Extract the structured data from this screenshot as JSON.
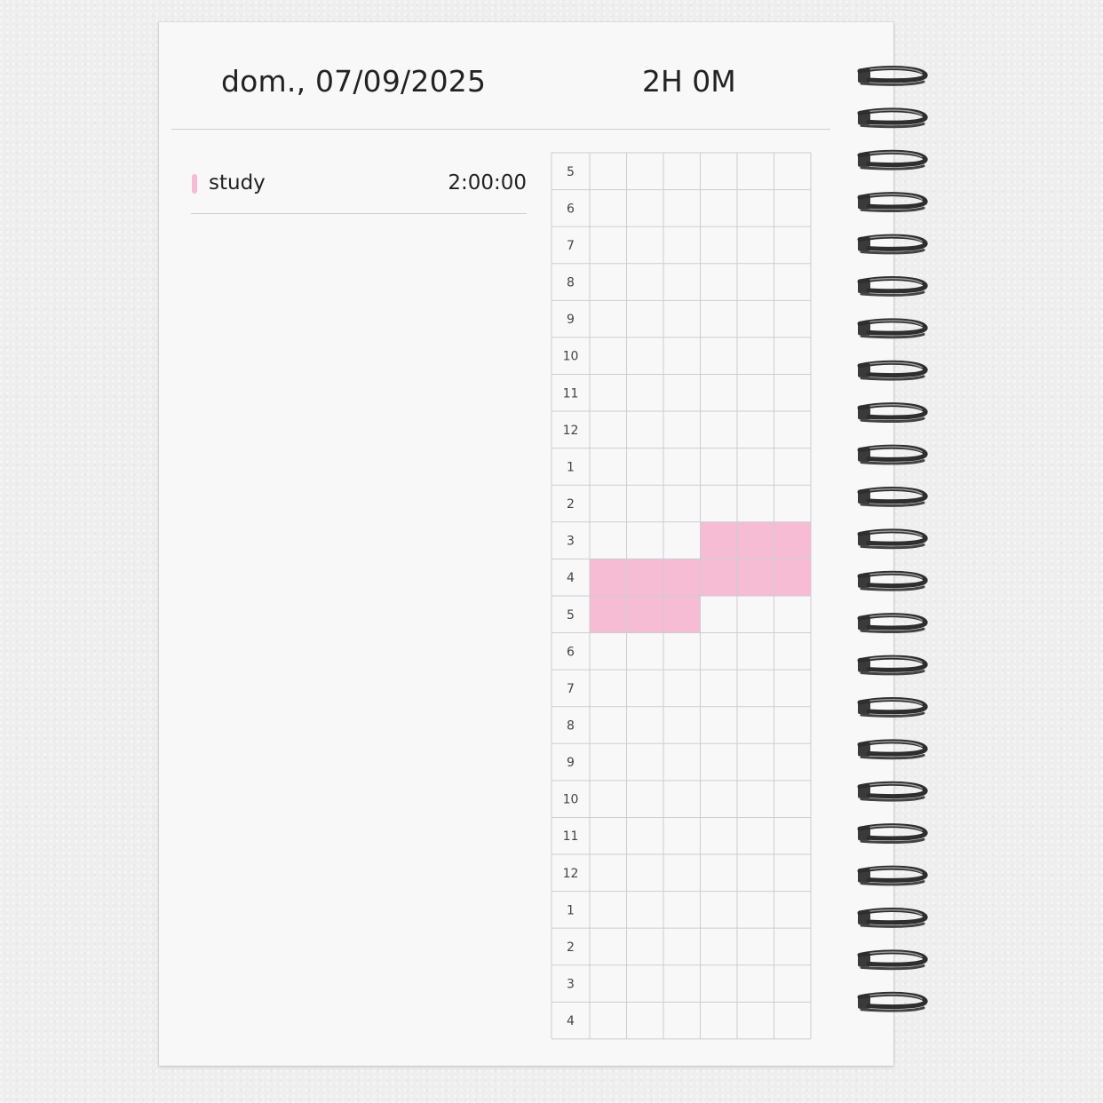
{
  "header": {
    "date": "dom., 07/09/2025",
    "total": "2H 0M"
  },
  "activities": [
    {
      "name": "study",
      "duration": "2:00:00",
      "color": "#f5bcd4"
    }
  ],
  "timeline": {
    "hour_labels": [
      "5",
      "6",
      "7",
      "8",
      "9",
      "10",
      "11",
      "12",
      "1",
      "2",
      "3",
      "4",
      "5",
      "6",
      "7",
      "8",
      "9",
      "10",
      "11",
      "12",
      "1",
      "2",
      "3",
      "4"
    ],
    "columns_per_hour": 6,
    "filled": [
      {
        "row": 10,
        "cols": [
          3,
          4,
          5
        ],
        "color": "#f5bcd4"
      },
      {
        "row": 11,
        "cols": [
          0,
          1,
          2,
          3,
          4,
          5
        ],
        "color": "#f5bcd4"
      },
      {
        "row": 12,
        "cols": [
          0,
          1,
          2
        ],
        "color": "#f5bcd4"
      }
    ]
  }
}
